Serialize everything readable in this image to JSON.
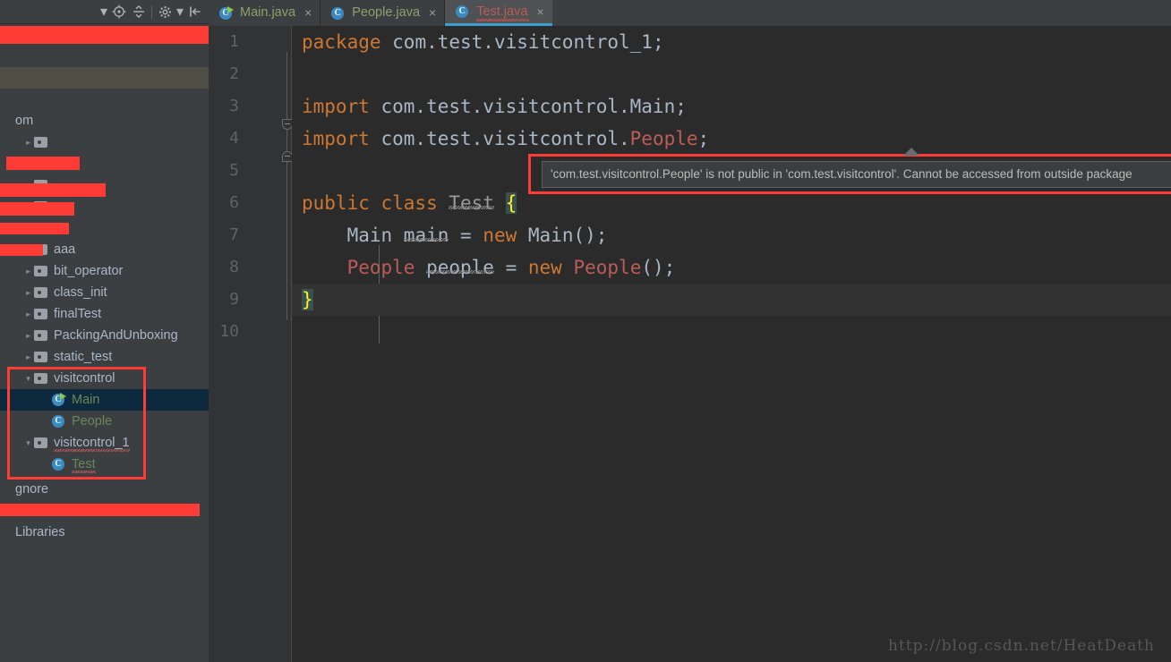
{
  "project_toolbar": {
    "buttons": [
      {
        "name": "view-options-caret",
        "icon": "chevron-down-icon",
        "label": "▾"
      },
      {
        "name": "scroll-from-source",
        "icon": "target-icon",
        "label": ""
      },
      {
        "name": "collapse-all",
        "icon": "collapse-all-icon",
        "label": ""
      },
      {
        "name": "settings",
        "icon": "gear-icon",
        "label": ""
      },
      {
        "name": "hide-panel",
        "icon": "hide-panel-icon",
        "label": ""
      }
    ]
  },
  "tree": {
    "rows": [
      {
        "label": "",
        "redacted": true,
        "depth": 0,
        "icon": "none",
        "arrow": "none",
        "sel": "none"
      },
      {
        "label": "",
        "redacted": false,
        "depth": 0,
        "icon": "none",
        "arrow": "none",
        "sel": "none"
      },
      {
        "label": "",
        "redacted": false,
        "depth": 0,
        "icon": "none",
        "arrow": "none",
        "sel": "olive"
      },
      {
        "label": "",
        "redacted": false,
        "depth": 0,
        "icon": "none",
        "arrow": "none",
        "sel": "none"
      },
      {
        "label": "om",
        "redacted": false,
        "depth": 0,
        "icon": "none",
        "arrow": "none",
        "sel": "none"
      },
      {
        "label": "",
        "redacted": true,
        "depth": 1,
        "icon": "folder",
        "arrow": "collapsed",
        "sel": "none"
      },
      {
        "label": "",
        "redacted": true,
        "depth": 1,
        "icon": "folder",
        "arrow": "collapsed",
        "sel": "none"
      },
      {
        "label": "",
        "redacted": true,
        "depth": 1,
        "icon": "folder",
        "arrow": "collapsed",
        "sel": "none"
      },
      {
        "label": "",
        "redacted": true,
        "depth": 1,
        "icon": "folder",
        "arrow": "collapsed",
        "sel": "none"
      },
      {
        "label": "",
        "redacted": true,
        "depth": 1,
        "icon": "folder",
        "arrow": "collapsed",
        "sel": "none"
      },
      {
        "label": "aaa",
        "redacted": false,
        "depth": 1,
        "icon": "folder",
        "arrow": "collapsed",
        "sel": "none"
      },
      {
        "label": "bit_operator",
        "redacted": false,
        "depth": 1,
        "icon": "folder",
        "arrow": "collapsed",
        "sel": "none"
      },
      {
        "label": "class_init",
        "redacted": false,
        "depth": 1,
        "icon": "folder",
        "arrow": "collapsed",
        "sel": "none"
      },
      {
        "label": "finalTest",
        "redacted": false,
        "depth": 1,
        "icon": "folder",
        "arrow": "collapsed",
        "sel": "none"
      },
      {
        "label": "PackingAndUnboxing",
        "redacted": false,
        "depth": 1,
        "icon": "folder",
        "arrow": "collapsed",
        "sel": "none"
      },
      {
        "label": "static_test",
        "redacted": false,
        "depth": 1,
        "icon": "folder",
        "arrow": "collapsed",
        "sel": "none"
      },
      {
        "label": "visitcontrol",
        "redacted": false,
        "depth": 1,
        "icon": "folder",
        "arrow": "expanded",
        "sel": "none"
      },
      {
        "label": "Main",
        "redacted": false,
        "depth": 2,
        "icon": "class-run",
        "arrow": "none",
        "sel": "blue",
        "green": true
      },
      {
        "label": "People",
        "redacted": false,
        "depth": 2,
        "icon": "class",
        "arrow": "none",
        "sel": "none",
        "green": true
      },
      {
        "label": "visitcontrol_1",
        "redacted": false,
        "depth": 1,
        "icon": "folder",
        "arrow": "expanded",
        "sel": "none",
        "squiggle": true
      },
      {
        "label": "Test",
        "redacted": false,
        "depth": 2,
        "icon": "class",
        "arrow": "none",
        "sel": "none",
        "green": true,
        "squiggle": true
      },
      {
        "label": "gnore",
        "redacted": false,
        "depth": 0,
        "icon": "none",
        "arrow": "none",
        "sel": "none"
      },
      {
        "label": "",
        "redacted": true,
        "depth": 0,
        "icon": "none",
        "arrow": "none",
        "sel": "none"
      },
      {
        "label": "Libraries",
        "redacted": false,
        "depth": 0,
        "icon": "none",
        "arrow": "none",
        "sel": "none"
      }
    ]
  },
  "tabs": [
    {
      "label": "Main.java",
      "icon": "java-class-run-icon",
      "active": false,
      "error": false,
      "close": "×"
    },
    {
      "label": "People.java",
      "icon": "java-class-icon",
      "active": false,
      "error": false,
      "close": "×"
    },
    {
      "label": "Test.java",
      "icon": "java-class-icon",
      "active": true,
      "error": true,
      "close": "×"
    }
  ],
  "editor": {
    "filename": "Test.java",
    "line_numbers": [
      "1",
      "2",
      "3",
      "4",
      "5",
      "6",
      "7",
      "8",
      "9",
      "10"
    ],
    "lines": [
      {
        "n": 1,
        "current": false,
        "tokens": [
          {
            "t": "package",
            "c": "kw"
          },
          {
            "t": " com.test.visitcontrol_1;",
            "c": "plain"
          }
        ]
      },
      {
        "n": 2,
        "current": false,
        "tokens": []
      },
      {
        "n": 3,
        "current": false,
        "tokens": [
          {
            "t": "import",
            "c": "kw"
          },
          {
            "t": " com.test.visitcontrol.Main;",
            "c": "plain"
          }
        ]
      },
      {
        "n": 4,
        "current": false,
        "tokens": [
          {
            "t": "import",
            "c": "kw"
          },
          {
            "t": " com.test.visitcontrol.",
            "c": "plain"
          },
          {
            "t": "People",
            "c": "err"
          },
          {
            "t": ";",
            "c": "plain"
          }
        ]
      },
      {
        "n": 5,
        "current": false,
        "tokens": []
      },
      {
        "n": 6,
        "current": false,
        "tokens": [
          {
            "t": "public class",
            "c": "kw"
          },
          {
            "t": " ",
            "c": "plain"
          },
          {
            "t": "Test",
            "c": "dim"
          },
          {
            "t": " ",
            "c": "plain"
          },
          {
            "t": "{",
            "c": "brace"
          }
        ]
      },
      {
        "n": 7,
        "current": false,
        "tokens": [
          {
            "t": "    Main ",
            "c": "plain"
          },
          {
            "t": "main",
            "c": "var"
          },
          {
            "t": " = ",
            "c": "plain"
          },
          {
            "t": "new",
            "c": "kw"
          },
          {
            "t": " Main();",
            "c": "plain"
          }
        ]
      },
      {
        "n": 8,
        "current": false,
        "tokens": [
          {
            "t": "    ",
            "c": "plain"
          },
          {
            "t": "People",
            "c": "err"
          },
          {
            "t": " ",
            "c": "plain"
          },
          {
            "t": "people",
            "c": "var"
          },
          {
            "t": " = ",
            "c": "plain"
          },
          {
            "t": "new",
            "c": "kw"
          },
          {
            "t": " ",
            "c": "plain"
          },
          {
            "t": "People",
            "c": "err"
          },
          {
            "t": "();",
            "c": "plain"
          }
        ]
      },
      {
        "n": 9,
        "current": true,
        "tokens": [
          {
            "t": "}",
            "c": "brace"
          }
        ]
      },
      {
        "n": 10,
        "current": false,
        "tokens": []
      }
    ]
  },
  "tooltip": {
    "message": "'com.test.visitcontrol.People' is not public in 'com.test.visitcontrol'. Cannot be accessed from outside package"
  },
  "watermark": {
    "text": "http://blog.csdn.net/HeatDeath"
  },
  "colors": {
    "panel_bg": "#3C3F41",
    "editor_bg": "#2B2B2B",
    "gutter_bg": "#313335",
    "accent_blue": "#3C9ECE",
    "redaction": "#FF3B36",
    "keyword": "#CC7832",
    "error_text": "#BC5C58",
    "tab_text": "#8CA06A",
    "tree_text": "#A9B7C6",
    "selection_blue": "#0D293E"
  }
}
